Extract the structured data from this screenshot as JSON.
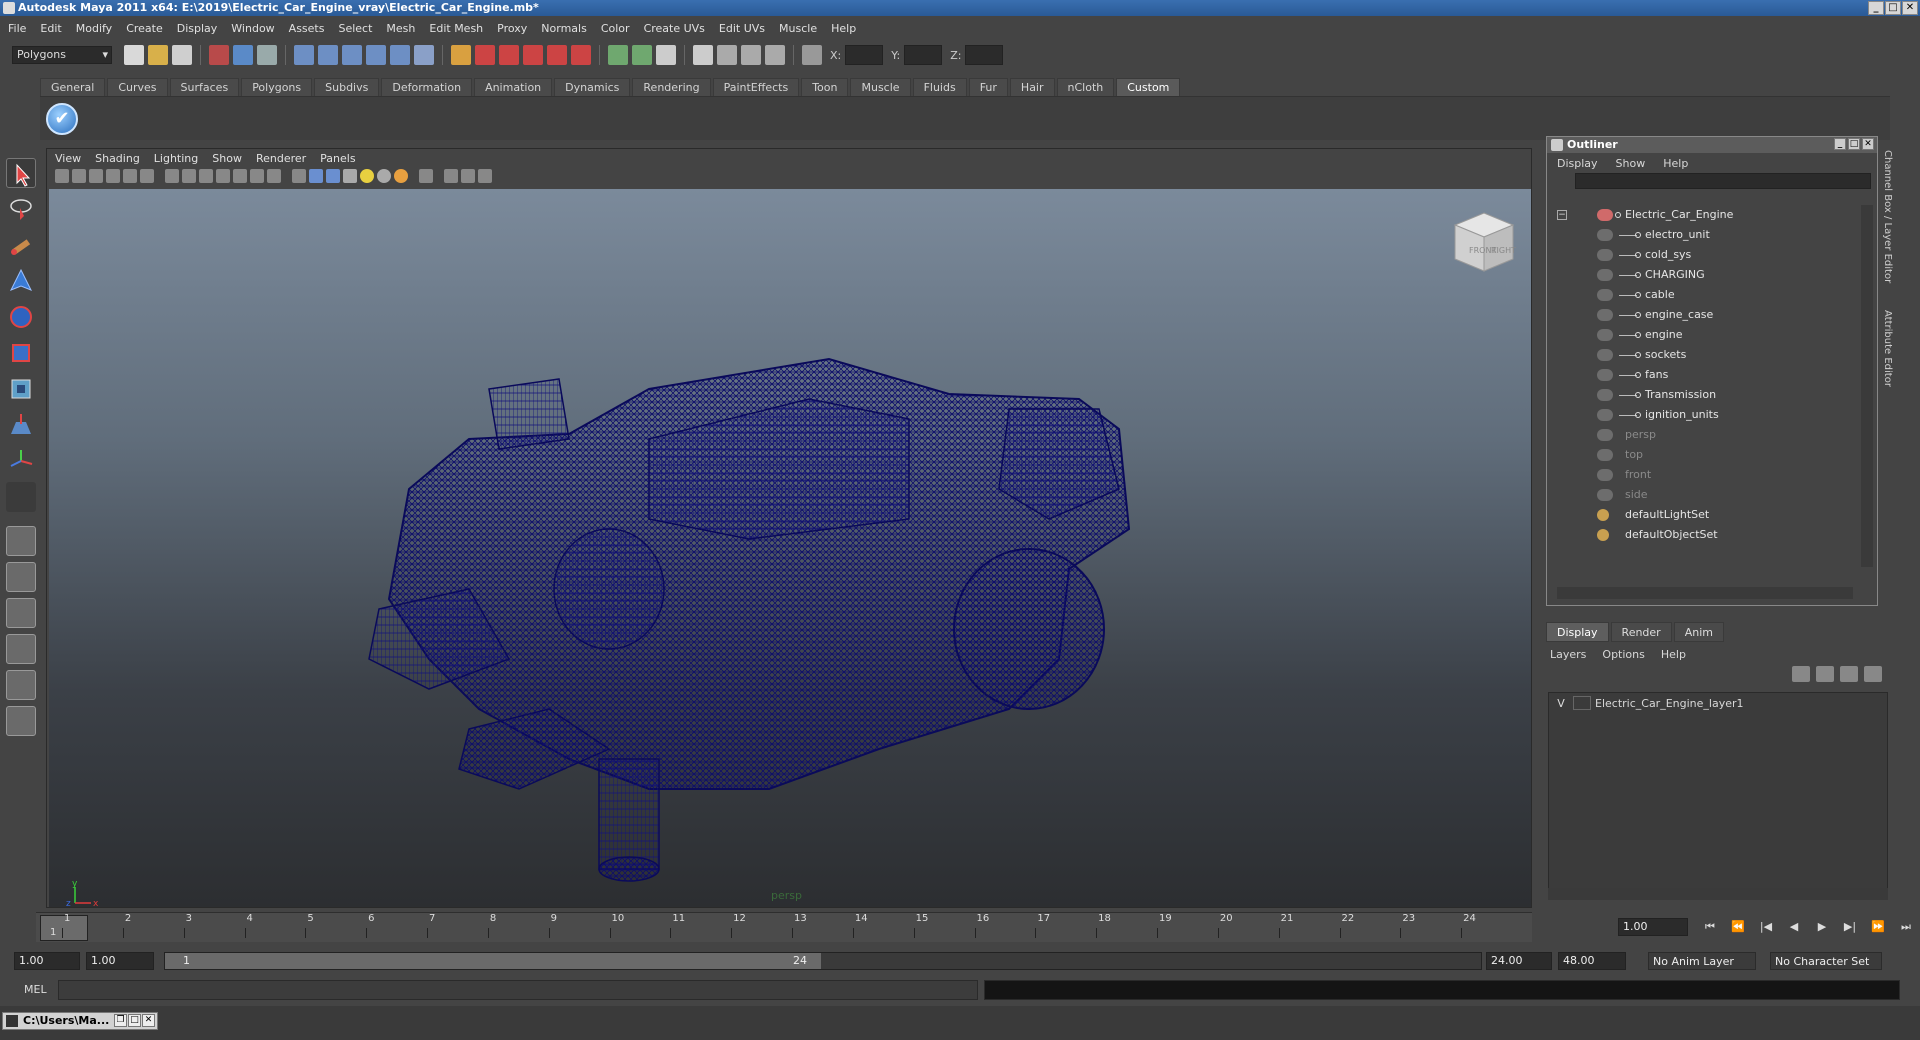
{
  "window": {
    "title": "Autodesk Maya 2011 x64: E:\\2019\\Electric_Car_Engine_vray\\Electric_Car_Engine.mb*",
    "buttons": [
      "minimize",
      "maximize",
      "close"
    ]
  },
  "menubar": [
    "File",
    "Edit",
    "Modify",
    "Create",
    "Display",
    "Window",
    "Assets",
    "Select",
    "Mesh",
    "Edit Mesh",
    "Proxy",
    "Normals",
    "Color",
    "Create UVs",
    "Edit UVs",
    "Muscle",
    "Help"
  ],
  "statusline": {
    "mode": "Polygons",
    "x_label": "X:",
    "y_label": "Y:",
    "z_label": "Z:"
  },
  "shelf": {
    "tabs": [
      "General",
      "Curves",
      "Surfaces",
      "Polygons",
      "Subdivs",
      "Deformation",
      "Animation",
      "Dynamics",
      "Rendering",
      "PaintEffects",
      "Toon",
      "Muscle",
      "Fluids",
      "Fur",
      "Hair",
      "nCloth",
      "Custom"
    ],
    "active_tab": "Custom",
    "custom_item": "check-icon"
  },
  "viewport": {
    "menu": [
      "View",
      "Shading",
      "Lighting",
      "Show",
      "Renderer",
      "Panels"
    ],
    "camera_label": "persp",
    "viewcube_faces": [
      "FRONT",
      "RIGHT"
    ],
    "axis_labels": [
      "y",
      "x",
      "z"
    ],
    "wire_color": "#0d0d6b"
  },
  "outliner": {
    "title": "Outliner",
    "menu": [
      "Display",
      "Show",
      "Help"
    ],
    "root": "Electric_Car_Engine",
    "children": [
      "electro_unit",
      "cold_sys",
      "CHARGING",
      "cable",
      "engine_case",
      "engine",
      "sockets",
      "fans",
      "Transmission",
      "ignition_units"
    ],
    "cameras": [
      "persp",
      "top",
      "front",
      "side"
    ],
    "sets": [
      "defaultLightSet",
      "defaultObjectSet"
    ]
  },
  "side_tabs": [
    "Channel Box / Layer Editor",
    "Attribute Editor"
  ],
  "layer_editor": {
    "tabs": [
      "Display",
      "Render",
      "Anim"
    ],
    "active_tab": "Display",
    "menu": [
      "Layers",
      "Options",
      "Help"
    ],
    "layers": [
      {
        "visible": "V",
        "name": "Electric_Car_Engine_layer1"
      }
    ]
  },
  "timeline": {
    "ticks": [
      "1",
      "2",
      "3",
      "4",
      "5",
      "6",
      "7",
      "8",
      "9",
      "10",
      "11",
      "12",
      "13",
      "14",
      "15",
      "16",
      "17",
      "18",
      "19",
      "20",
      "21",
      "22",
      "23",
      "24"
    ],
    "current_frame_label": "1",
    "current_frame": "1.00"
  },
  "range": {
    "start_time": "1.00",
    "playback_start": "1.00",
    "range_start_label": "1",
    "range_end_label": "24",
    "playback_end": "24.00",
    "end_time": "48.00",
    "anim_layer": "No Anim Layer",
    "character_set": "No Character Set"
  },
  "commandline": {
    "label": "MEL"
  },
  "taskbar": {
    "item": "C:\\Users\\Ma..."
  }
}
